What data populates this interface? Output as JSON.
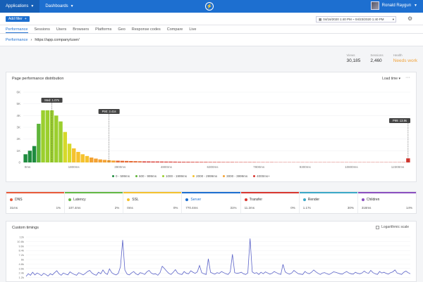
{
  "topbar": {
    "applications_label": "Applications",
    "dashboards_label": "Dashboards",
    "user_name": "Ronald Raygun"
  },
  "filterbar": {
    "chip_label": "Add filter",
    "date_range": "04/16/2020 1:40 PM ~ 04/23/2020 1:40 PM"
  },
  "tabs": [
    {
      "label": "Performance",
      "active": true
    },
    {
      "label": "Sessions"
    },
    {
      "label": "Users"
    },
    {
      "label": "Browsers"
    },
    {
      "label": "Platforms"
    },
    {
      "label": "Geo"
    },
    {
      "label": "Response codes"
    },
    {
      "label": "Compare"
    },
    {
      "label": "Live"
    }
  ],
  "breadcrumb": {
    "root": "Performance",
    "current": "https://app.company/user/"
  },
  "stats": [
    {
      "label": "Views",
      "value": "30,185"
    },
    {
      "label": "Sessions",
      "value": "2,460"
    },
    {
      "label": "Health",
      "value": "Needs work",
      "status": "warn"
    }
  ],
  "distribution_panel": {
    "title": "Page performance distribution",
    "load_time_label": "Load time",
    "markers": {
      "median": "Med: 1.07s",
      "p90": "P90: 3.41s",
      "p99": "P99: 13.8s"
    }
  },
  "chart_data": [
    {
      "type": "bar",
      "title": "Page performance distribution",
      "ylim": [
        0,
        6000
      ],
      "y_ticks": [
        "0",
        "1K",
        "2K",
        "3K",
        "4K",
        "5K",
        "6K"
      ],
      "x_ticks": [
        "0ms",
        "1800ms",
        "3900ms",
        "4800ms",
        "6300ms",
        "7800ms",
        "9300ms",
        "10800ms",
        "12300ms"
      ],
      "values": [
        700,
        1000,
        1400,
        3300,
        4450,
        4450,
        4450,
        4000,
        3500,
        2600,
        1600,
        1200,
        900,
        700,
        550,
        420,
        330,
        260,
        220,
        190,
        160,
        150,
        140,
        130,
        120,
        110,
        100,
        90,
        85,
        80,
        80,
        75,
        70,
        70,
        65,
        60,
        55,
        55,
        50,
        50,
        45,
        45,
        40,
        40,
        40,
        35,
        35,
        35,
        30,
        30,
        30,
        30,
        30,
        25,
        25,
        25,
        25,
        20,
        20,
        20,
        20,
        20,
        20,
        20,
        20,
        20,
        20,
        20,
        20,
        20,
        20,
        20,
        20,
        20,
        20,
        20,
        20,
        20,
        20,
        20,
        20,
        20,
        20,
        20,
        20,
        20,
        20,
        350
      ],
      "bucket_colors": [
        "#1f8c3f",
        "#1f8c3f",
        "#1f8c3f",
        "#5fb53a",
        "#9bcf2e",
        "#9bcf2e",
        "#9bcf2e",
        "#9bcf2e",
        "#9bcf2e",
        "#d5d92a",
        "#d5d92a",
        "#f5c22e",
        "#f5c22e",
        "#f5c22e",
        "#f5c22e",
        "#f3a233",
        "#f3a233",
        "#f3a233",
        "#f3a233",
        "#f3a233",
        "#f3a233",
        "#e56a35",
        "#e56a35",
        "#e56a35",
        "#e56a35",
        "#e56a35",
        "#e56a35",
        "#d8362f"
      ],
      "legend": [
        {
          "label": "0 - 599ms",
          "color": "#1f8c3f"
        },
        {
          "label": "600 - 999ms",
          "color": "#5fb53a"
        },
        {
          "label": "1000 - 1999ms",
          "color": "#9bcf2e"
        },
        {
          "label": "2000 - 2999ms",
          "color": "#f5c22e"
        },
        {
          "label": "3000 - 3999ms",
          "color": "#f3a233"
        },
        {
          "label": "4000ms+",
          "color": "#d8362f"
        }
      ]
    },
    {
      "type": "line",
      "title": "Custom timings",
      "ylim": [
        0,
        12000
      ],
      "y_ticks": [
        "0",
        "1.2k",
        "2.4k",
        "3.6k",
        "4.8k",
        "6k",
        "7.2k",
        "8.4k",
        "9.6k",
        "10.8k",
        "12k"
      ],
      "color": "#5b63c8",
      "values": [
        1500,
        2200,
        1800,
        2600,
        1900,
        2400,
        2100,
        1700,
        2300,
        2000,
        1600,
        2200,
        1900,
        2500,
        3000,
        2200,
        1800,
        2400,
        2100,
        1900,
        2700,
        2300,
        2000,
        1800,
        2500,
        2200,
        1900,
        2300,
        2800,
        3100,
        2400,
        2000,
        1800,
        2600,
        2200,
        3200,
        2400,
        2000,
        3500,
        2500,
        2100,
        1900,
        2300,
        4100,
        11200,
        3200,
        2100,
        1900,
        2400,
        2800,
        2200,
        1900,
        2500,
        2300,
        2000,
        2700,
        3100,
        2400,
        2100,
        2200,
        1800,
        2500,
        4200,
        3600,
        2900,
        2300,
        2000,
        2600,
        3300,
        2400,
        2100,
        2000,
        2800,
        2300,
        2200,
        3000,
        2600,
        2300,
        2700,
        4400,
        2500,
        2200,
        2000,
        6200,
        2600,
        2300,
        2100,
        2500,
        2300,
        2800,
        2500,
        2200,
        2000,
        2700,
        7400,
        2500,
        2300,
        2400,
        2600,
        2200,
        2000,
        2400,
        11600,
        2700,
        2300,
        2500,
        2000,
        2600,
        2200,
        2700,
        2400,
        2100,
        2300,
        2800,
        2500,
        2200,
        2000,
        4700,
        2700,
        2300,
        2100,
        2400,
        3100,
        2600,
        2200,
        2100,
        2000,
        2800,
        2400,
        2200,
        2600,
        3200,
        2700,
        2300,
        2000,
        2400,
        2500,
        2200,
        2000,
        2300,
        2700,
        2600,
        2400,
        2200,
        2100,
        2500,
        2800,
        2400,
        2200,
        2100,
        2600,
        2300,
        2200,
        2400,
        2900,
        2500,
        2300,
        3100,
        2500,
        2200,
        2000,
        2800,
        2400,
        2600,
        2300,
        2100,
        2500,
        2700,
        3200,
        2400,
        2200,
        2000,
        2600,
        2900,
        2500,
        2200
      ]
    }
  ],
  "timings": [
    {
      "name": "DNS",
      "value": "31ms",
      "percent": "1%",
      "color": "#e85a3a"
    },
    {
      "name": "Latency",
      "value": "107.4ms",
      "percent": "2%",
      "color": "#62b844"
    },
    {
      "name": "SSL",
      "value": "0ms",
      "percent": "0%",
      "color": "#f5c22e"
    },
    {
      "name": "Server",
      "value": "770.4ms",
      "percent": "31%",
      "color": "#1d6fd0"
    },
    {
      "name": "Transfer",
      "value": "11.2ms",
      "percent": "0%",
      "color": "#d8362f"
    },
    {
      "name": "Render",
      "value": "1.17s",
      "percent": "30%",
      "color": "#3ba8c7"
    },
    {
      "name": "Children",
      "value": "318ms",
      "percent": "14%",
      "color": "#8a4fbf"
    }
  ],
  "custom_panel": {
    "title": "Custom timings",
    "log_scale_label": "Logarithmic scale"
  }
}
